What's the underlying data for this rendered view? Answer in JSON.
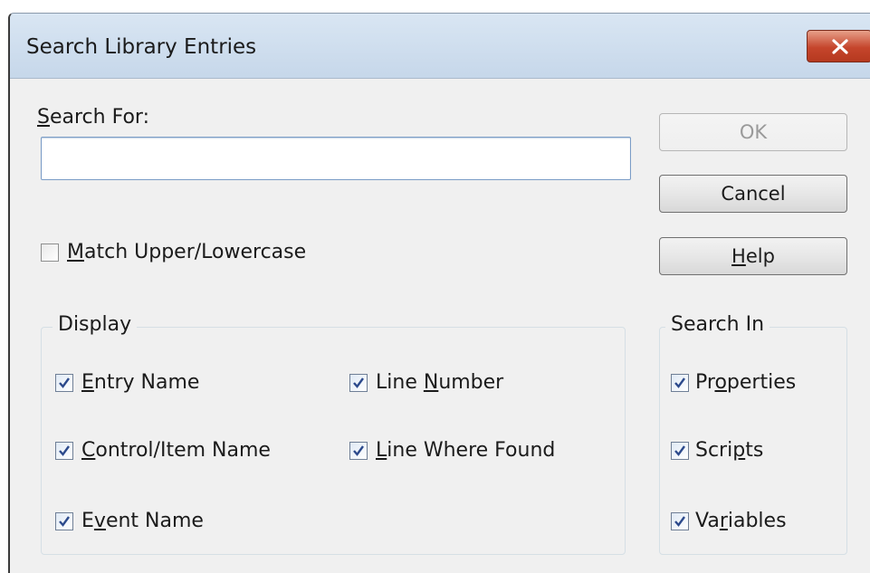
{
  "window": {
    "title": "Search Library Entries"
  },
  "search": {
    "label_prefix": "S",
    "label_rest": "earch For:",
    "value": ""
  },
  "match_case": {
    "checked": false,
    "label_prefix": "M",
    "label_rest": "atch Upper/Lowercase"
  },
  "buttons": {
    "ok": "OK",
    "cancel": "Cancel",
    "help_prefix": "H",
    "help_rest": "elp"
  },
  "display": {
    "legend": "Display",
    "entry_name": {
      "checked": true,
      "pre": "",
      "key": "E",
      "post": "ntry Name"
    },
    "line_number": {
      "checked": true,
      "pre": "Line ",
      "key": "N",
      "post": "umber"
    },
    "control_item_name": {
      "checked": true,
      "pre": "",
      "key": "C",
      "post": "ontrol/Item Name"
    },
    "line_where_found": {
      "checked": true,
      "pre": "",
      "key": "L",
      "post": "ine Where Found"
    },
    "event_name": {
      "checked": true,
      "pre": "E",
      "key": "v",
      "post": "ent Name"
    }
  },
  "search_in": {
    "legend": "Search In",
    "properties": {
      "checked": true,
      "pre": "Pr",
      "key": "o",
      "post": "perties"
    },
    "scripts": {
      "checked": true,
      "pre": "Scri",
      "key": "p",
      "post": "ts"
    },
    "variables": {
      "checked": true,
      "pre": "Va",
      "key": "r",
      "post": "iables"
    }
  },
  "colors": {
    "title_bar": "#d3e1f0",
    "close_button": "#c5452c",
    "dialog_bg": "#f0f0f0"
  },
  "icons": {
    "close": "close-icon",
    "check": "checkmark-icon"
  }
}
